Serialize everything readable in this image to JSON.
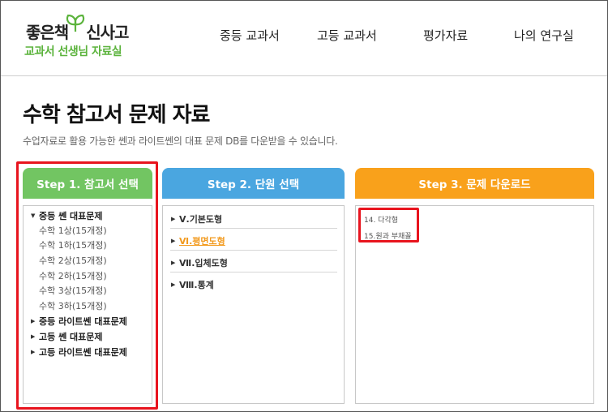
{
  "logo": {
    "main_left": "좋은책",
    "main_right": "신사고",
    "sub": "교과서 선생님 자료실",
    "brand_color": "#5bb33c"
  },
  "nav": [
    "중등 교과서",
    "고등 교과서",
    "평가자료",
    "나의 연구실"
  ],
  "page": {
    "title": "수학 참고서 문제 자료",
    "description": "수업자료로 활용 가능한 쎈과 라이트쎈의 대표 문제 DB를 다운받을 수 있습니다."
  },
  "step1": {
    "title": "Step 1. 참고서 선택",
    "color": "#72c562",
    "expanded_group": "중등 쎈 대표문제",
    "books": [
      "수학 1상(15개정)",
      "수학 1하(15개정)",
      "수학 2상(15개정)",
      "수학 2하(15개정)",
      "수학 3상(15개정)",
      "수학 3하(15개정)"
    ],
    "groups": [
      "중등 라이트쎈 대표문제",
      "고등 쎈 대표문제",
      "고등 라이트쎈 대표문제"
    ]
  },
  "step2": {
    "title": "Step 2. 단원 선택",
    "color": "#4aa6e0",
    "units": [
      "Ⅴ.기본도형",
      "Ⅵ.평면도형",
      "Ⅶ.입체도형",
      "Ⅷ.통계"
    ],
    "active_unit": "Ⅵ.평면도형"
  },
  "step3": {
    "title": "Step 3. 문제 다운로드",
    "color": "#f9a11b",
    "items": [
      "14. 다각형",
      "15.원과 부채꼴"
    ]
  },
  "icons": {
    "expanded": "triangle-down-icon",
    "collapsed": "triangle-right-icon",
    "unit_bullet": "triangle-right-icon",
    "logo_mark": "sprout-icon"
  }
}
